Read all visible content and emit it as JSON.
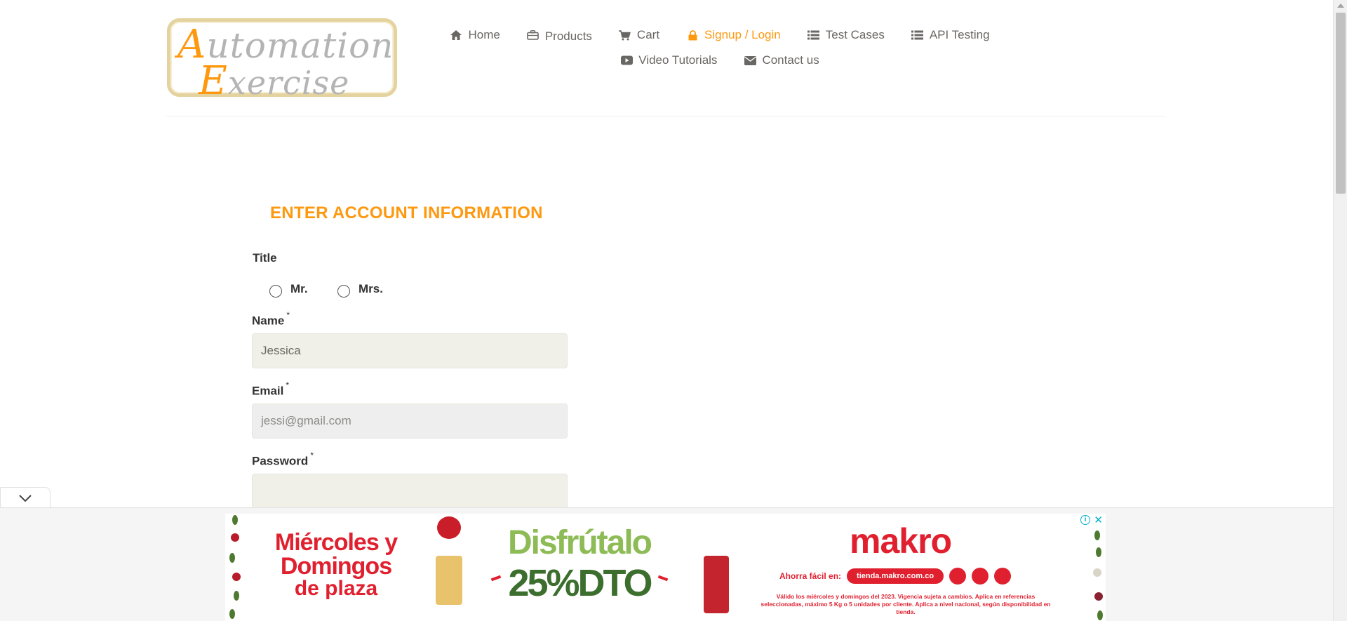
{
  "nav": {
    "items": [
      {
        "label": "Home",
        "icon": "home-icon"
      },
      {
        "label": "Products",
        "icon": "briefcase-icon"
      },
      {
        "label": "Cart",
        "icon": "cart-icon"
      },
      {
        "label": "Signup / Login",
        "icon": "lock-icon",
        "active": true
      },
      {
        "label": "Test Cases",
        "icon": "list-icon"
      },
      {
        "label": "API Testing",
        "icon": "list-icon"
      },
      {
        "label": "Video Tutorials",
        "icon": "youtube-icon"
      },
      {
        "label": "Contact us",
        "icon": "envelope-icon"
      }
    ]
  },
  "logo": {
    "line1_cap": "A",
    "line1_rest": "utomation",
    "line2_cap": "E",
    "line2_rest": "xercise"
  },
  "form": {
    "title": "ENTER ACCOUNT INFORMATION",
    "title_label": "Title",
    "mr_label": "Mr.",
    "mrs_label": "Mrs.",
    "name_label": "Name",
    "name_value": "Jessica",
    "email_label": "Email",
    "email_value": "jessi@gmail.com",
    "password_label": "Password",
    "password_value": "",
    "required_mark": "*"
  },
  "ad": {
    "left_line1": "Miércoles y",
    "left_line2": "Domingos",
    "left_line3": "de plaza",
    "headline": "Disfrútalo",
    "discount": "25%DTO",
    "brand": "makro",
    "ahorra": "Ahorra fácil en:",
    "site": "tienda.makro.com.co",
    "legal": "Válido los miércoles y domingos del 2023. Vigencia sujeta a cambios. Aplica en referencias seleccionadas, máximo 5 Kg o 5 unidades por cliente. Aplica a nivel nacional, según disponibilidad en tienda.",
    "info_glyph": "i",
    "close_glyph": "✕"
  },
  "colors": {
    "accent": "#fe980f",
    "text": "#696763",
    "input_bg": "#f0f0e9",
    "ad_red": "#e0202f"
  }
}
